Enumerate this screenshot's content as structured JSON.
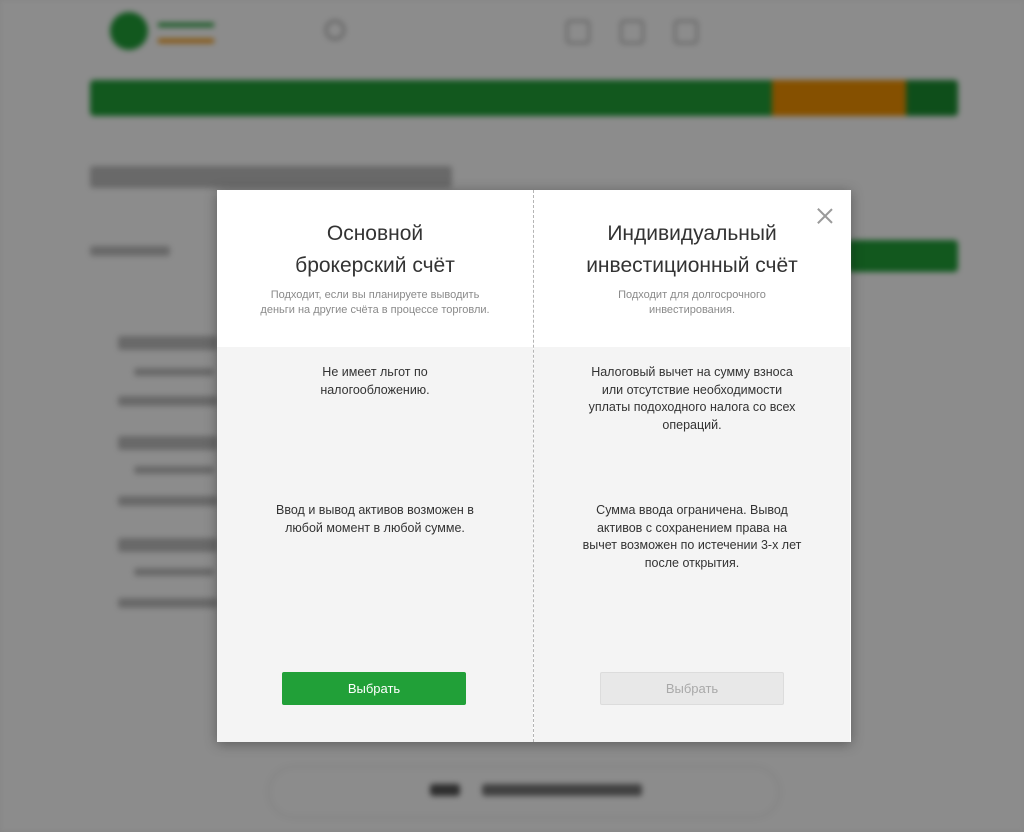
{
  "modal": {
    "left_column": {
      "title": "Основной\nброкерский счёт",
      "description": "Подходит, если вы планируете выводить\nденьги на другие счёта в процессе торговли.",
      "feature_tax": "Не имеет льгот по\nналогообложению.",
      "feature_assets": "Ввод и вывод активов возможен в\nлюбой момент в любой сумме.",
      "button_label": "Выбрать"
    },
    "right_column": {
      "title": "Индивидуальный\nинвестиционный счёт",
      "description": "Подходит для долгосрочного\nинвестирования.",
      "feature_tax": "Налоговый вычет на сумму взноса\nили отсутствие необходимости\nуплаты подоходного налога со всех\nопераций.",
      "feature_assets": "Сумма ввода ограничена. Вывод\nактивов с сохранением права на\nвычет возможен по истечении 3-х лет\nпосле открытия.",
      "button_label": "Выбрать"
    },
    "close_icon": "close-icon"
  },
  "colors": {
    "accent_green": "#21a038",
    "accent_orange": "#f39200"
  }
}
